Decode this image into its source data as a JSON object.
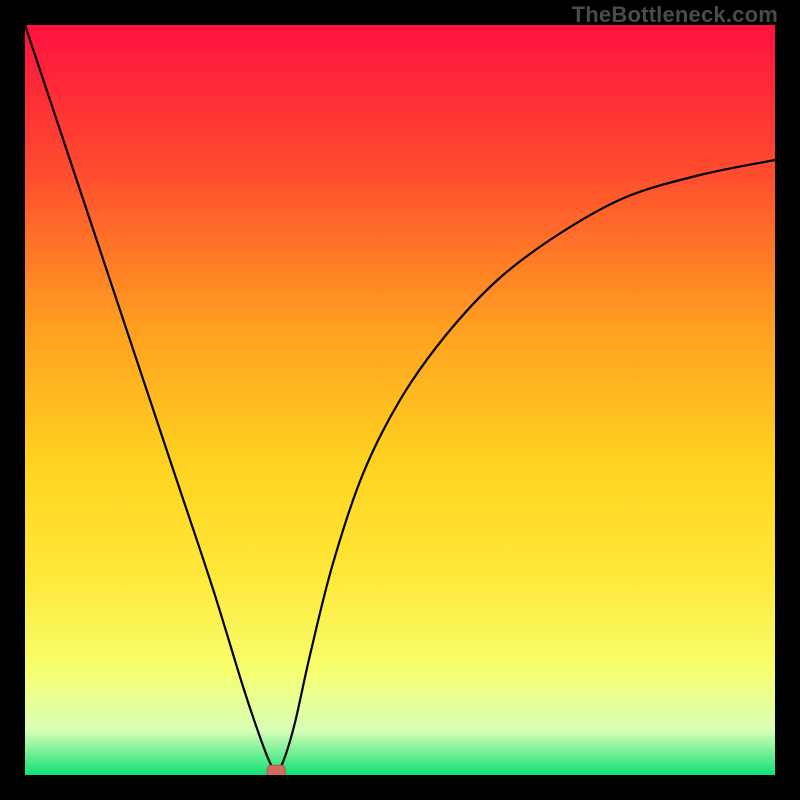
{
  "watermark": "TheBottleneck.com",
  "colors": {
    "background": "#000000",
    "curve": "#000000",
    "marker_fill": "#d46a5f",
    "marker_stroke": "#c44f45",
    "gradient_top": "#ff1040",
    "gradient_mid_upper": "#ff7c22",
    "gradient_mid": "#ffd21f",
    "gradient_mid_lower": "#ffe93a",
    "gradient_lower": "#f6ff6e",
    "gradient_lowest": "#d9ffb7",
    "gradient_bottom": "#10e077"
  },
  "chart_data": {
    "type": "line",
    "title": "",
    "xlabel": "",
    "ylabel": "",
    "xlim": [
      0,
      1
    ],
    "ylim": [
      0,
      1
    ],
    "note": "Axes are implicit (no tick labels shown). x is normalized horizontal position across the plot; y is normalized vertical magnitude where 0 is the green baseline and 1 is the top. Curve shows steep left descent to a minimum near x≈0.33, then a concave rise flattening toward the right edge.",
    "series": [
      {
        "name": "bottleneck-curve",
        "x": [
          0.0,
          0.05,
          0.1,
          0.15,
          0.2,
          0.25,
          0.29,
          0.31,
          0.325,
          0.335,
          0.345,
          0.36,
          0.38,
          0.41,
          0.45,
          0.5,
          0.56,
          0.63,
          0.71,
          0.8,
          0.9,
          1.0
        ],
        "y": [
          1.0,
          0.85,
          0.7,
          0.55,
          0.4,
          0.25,
          0.12,
          0.06,
          0.02,
          0.005,
          0.02,
          0.07,
          0.16,
          0.28,
          0.4,
          0.5,
          0.585,
          0.66,
          0.72,
          0.77,
          0.8,
          0.82
        ]
      }
    ],
    "marker": {
      "x": 0.335,
      "y": 0.005,
      "shape": "rounded-rect"
    }
  }
}
